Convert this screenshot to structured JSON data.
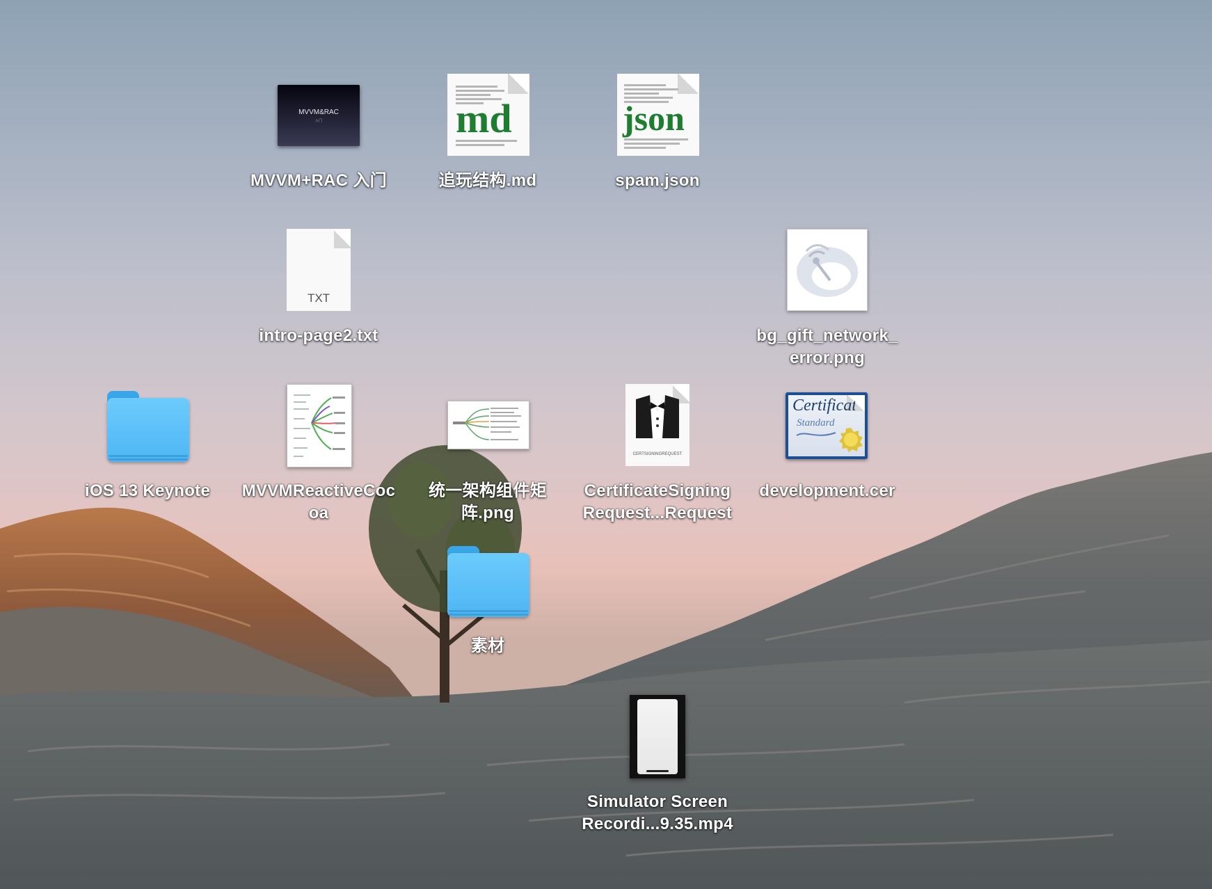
{
  "desktop": {
    "icons": [
      {
        "label": "MVVM+RAC 入门",
        "kind": "keynote",
        "slide_title": "MVVM&RAC",
        "slide_sub": "入门"
      },
      {
        "label": "追玩结构.md",
        "kind": "md",
        "badge": "md"
      },
      {
        "label": "spam.json",
        "kind": "json",
        "badge": "json"
      },
      {
        "label": "intro-page2.txt",
        "kind": "txt",
        "badge": "TXT"
      },
      {
        "label": "bg_gift_network_\nerror.png",
        "kind": "png-network"
      },
      {
        "label": "iOS 13 Keynote",
        "kind": "folder"
      },
      {
        "label": "MVVMReactiveCoc\noa",
        "kind": "pdf-mindmap"
      },
      {
        "label": "统一架构组件矩\n阵.png",
        "kind": "png-mindmap"
      },
      {
        "label": "CertificateSigning\nRequest...Request",
        "kind": "csr",
        "badge": "CERTSIGNINGREQUEST"
      },
      {
        "label": "development.cer",
        "kind": "cer",
        "badge_top": "Certificate",
        "badge_sub": "Standard"
      },
      {
        "label": "素材",
        "kind": "folder"
      },
      {
        "label": "Simulator Screen\nRecordi...9.35.mp4",
        "kind": "mp4"
      }
    ]
  },
  "colors": {
    "folder": "#5ec2f8",
    "label_text": "#ffffff",
    "md_green": "#1f7d32"
  }
}
